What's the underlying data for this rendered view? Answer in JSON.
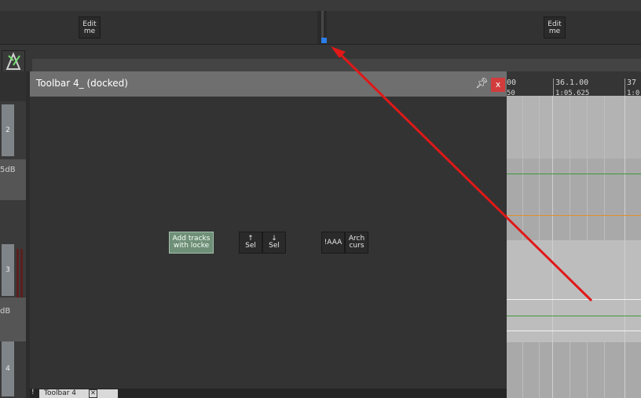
{
  "top_bar": {
    "edit_buttons": [
      {
        "label": "Edit\nme"
      },
      {
        "label": "Edit\nme"
      }
    ]
  },
  "tcp": {
    "tracks": [
      {
        "number": "2",
        "volume_text": "5dB"
      },
      {
        "number": "3",
        "volume_text": "dB"
      },
      {
        "number": "4",
        "volume_text": ""
      }
    ]
  },
  "ruler": {
    "markers": [
      {
        "bar": "00",
        "time": "50"
      },
      {
        "bar": "36.1.00",
        "time": "1:05.625"
      },
      {
        "bar": "37",
        "time": "1:0"
      }
    ]
  },
  "toolbar_panel": {
    "title": "Toolbar 4_ (docked)",
    "pin_icon": "pin-icon",
    "close_label": "x",
    "buttons": [
      {
        "label": "Add tracks\nwith locke",
        "active": true
      },
      {
        "label": "↑\nSel",
        "active": false
      },
      {
        "label": "↓\nSel",
        "active": false
      },
      {
        "label": "!AAA",
        "active": false
      },
      {
        "label": "Arch\ncurs",
        "active": false
      }
    ],
    "tab": {
      "bang": "!",
      "label": "Toolbar 4",
      "close": "✕"
    }
  },
  "colors": {
    "accent_blue": "#2b7de9",
    "close_red": "#d23c3c",
    "active_button": "#6f8f78",
    "annotation_arrow": "#e01818",
    "lane_green": "#3f9a3f",
    "lane_orange": "#e0902c"
  }
}
